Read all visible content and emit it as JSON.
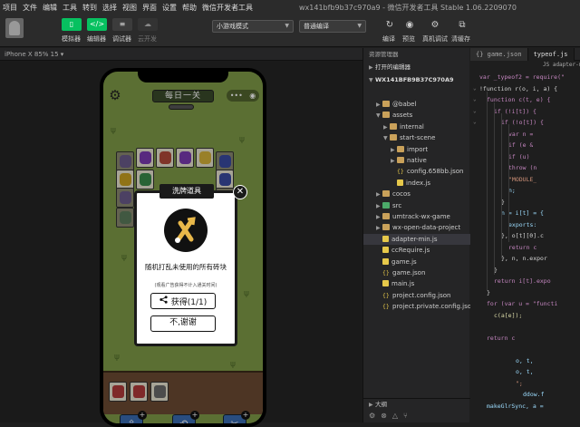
{
  "menu": {
    "items": [
      "项目",
      "文件",
      "编辑",
      "工具",
      "转到",
      "选择",
      "视图",
      "界面",
      "设置",
      "帮助",
      "微信开发者工具"
    ],
    "window_title": "wx141bfb9b37c970a9 - 微信开发者工具 Stable 1.06.2209070"
  },
  "toolbar": {
    "simulator_label": "模拟器",
    "editor_label": "编辑器",
    "debugger_label": "调试器",
    "cloud_label": "云开发",
    "mode_select": "小游戏模式",
    "compile_select": "普通编译",
    "compile_label": "编译",
    "preview_label": "预览",
    "realdebug_label": "真机调试",
    "clearcache_label": "清缓存",
    "editor_btn_glyph": "</>"
  },
  "simulator": {
    "device": "iPhone X 85% 15 ▾",
    "level_title": "每日一关",
    "capsule_dots": "•••",
    "capsule_target": "◉"
  },
  "dialog": {
    "title": "洗牌道具",
    "close": "✕",
    "description": "随机打乱未使用的所有砖块",
    "hint": "(观看广告获得不计入通关时间)",
    "get_button": "获得(1/1)",
    "cancel_button": "不,谢谢"
  },
  "explorer": {
    "header": "资源管理器",
    "open_editors": "打开的编辑器",
    "project": "WX141BFB9B37C970A9",
    "outline": "大纲",
    "tree": [
      {
        "label": "@babel",
        "depth": 1,
        "type": "folder",
        "expanded": false
      },
      {
        "label": "assets",
        "depth": 1,
        "type": "folder",
        "expanded": true
      },
      {
        "label": "internal",
        "depth": 2,
        "type": "folder",
        "expanded": false
      },
      {
        "label": "start-scene",
        "depth": 2,
        "type": "folder",
        "expanded": true
      },
      {
        "label": "import",
        "depth": 3,
        "type": "folder",
        "expanded": false
      },
      {
        "label": "native",
        "depth": 3,
        "type": "folder",
        "expanded": false
      },
      {
        "label": "config.658bb.json",
        "depth": 3,
        "type": "json"
      },
      {
        "label": "index.js",
        "depth": 3,
        "type": "js"
      },
      {
        "label": "cocos",
        "depth": 1,
        "type": "folder",
        "expanded": false
      },
      {
        "label": "src",
        "depth": 1,
        "type": "folder-green",
        "expanded": false
      },
      {
        "label": "umtrack-wx-game",
        "depth": 1,
        "type": "folder",
        "expanded": false
      },
      {
        "label": "wx-open-data-project",
        "depth": 1,
        "type": "folder",
        "expanded": false
      },
      {
        "label": "adapter-min.js",
        "depth": 1,
        "type": "js",
        "selected": true
      },
      {
        "label": "ccRequire.js",
        "depth": 1,
        "type": "js"
      },
      {
        "label": "game.js",
        "depth": 1,
        "type": "js"
      },
      {
        "label": "game.json",
        "depth": 1,
        "type": "json"
      },
      {
        "label": "main.js",
        "depth": 1,
        "type": "js"
      },
      {
        "label": "project.config.json",
        "depth": 1,
        "type": "json"
      },
      {
        "label": "project.private.config.json",
        "depth": 1,
        "type": "json"
      }
    ]
  },
  "editor": {
    "tabs": [
      {
        "label": "{} game.json",
        "active": false
      },
      {
        "label": "typeof.js",
        "active": true
      }
    ],
    "breadcrumb": "JS adapter-min",
    "lines": [
      {
        "text": "var _typeof2 = require(\"",
        "indent": 0,
        "cls": "kw"
      },
      {
        "text": "!function r(o, i, a) {",
        "indent": 0,
        "cls": "pl"
      },
      {
        "text": "function c(t, e) {",
        "indent": 1,
        "cls": "kw"
      },
      {
        "text": "if (!i[t]) {",
        "indent": 2,
        "cls": "kw"
      },
      {
        "text": "if (!o[t]) {",
        "indent": 3,
        "cls": "kw"
      },
      {
        "text": "var n =",
        "indent": 4,
        "cls": "kw"
      },
      {
        "text": "if (e &",
        "indent": 4,
        "cls": "kw"
      },
      {
        "text": "if (u)",
        "indent": 4,
        "cls": "kw"
      },
      {
        "text": "throw (n",
        "indent": 4,
        "cls": "kw"
      },
      {
        "text": "\"MODULE_",
        "indent": 4,
        "cls": "str"
      },
      {
        "text": "n;",
        "indent": 4,
        "cls": "var"
      },
      {
        "text": "}",
        "indent": 3,
        "cls": "pl"
      },
      {
        "text": "n = i[t] = {",
        "indent": 3,
        "cls": "var"
      },
      {
        "text": "exports:",
        "indent": 4,
        "cls": "var"
      },
      {
        "text": "}, o[t][0].c",
        "indent": 3,
        "cls": "pl"
      },
      {
        "text": "return c",
        "indent": 4,
        "cls": "kw"
      },
      {
        "text": "}, n, n.expor",
        "indent": 3,
        "cls": "pl"
      },
      {
        "text": "}",
        "indent": 2,
        "cls": "pl"
      },
      {
        "text": "return i[t].expo",
        "indent": 2,
        "cls": "kw"
      },
      {
        "text": "}",
        "indent": 1,
        "cls": "pl"
      },
      {
        "text": "for (var u = \"functi",
        "indent": 1,
        "cls": "kw"
      },
      {
        "text": "c(a[e]);",
        "indent": 2,
        "cls": "fn"
      },
      {
        "text": "",
        "indent": 0,
        "cls": "pl"
      },
      {
        "text": "return c",
        "indent": 1,
        "cls": "kw"
      },
      {
        "text": "",
        "indent": 0,
        "cls": "pl"
      },
      {
        "text": "o, t,",
        "indent": 5,
        "cls": "var"
      },
      {
        "text": "o, t,",
        "indent": 5,
        "cls": "var"
      },
      {
        "text": "\";",
        "indent": 5,
        "cls": "str"
      },
      {
        "text": "ddow.f",
        "indent": 6,
        "cls": "var"
      },
      {
        "text": "makeGlrSync, a =",
        "indent": 1,
        "cls": "var"
      }
    ]
  },
  "colors": {
    "accent_green": "#07c160",
    "game_bg": "#7f9a47",
    "shelf_brown": "#6b4a32",
    "prop_blue": "#3a6bb0"
  }
}
